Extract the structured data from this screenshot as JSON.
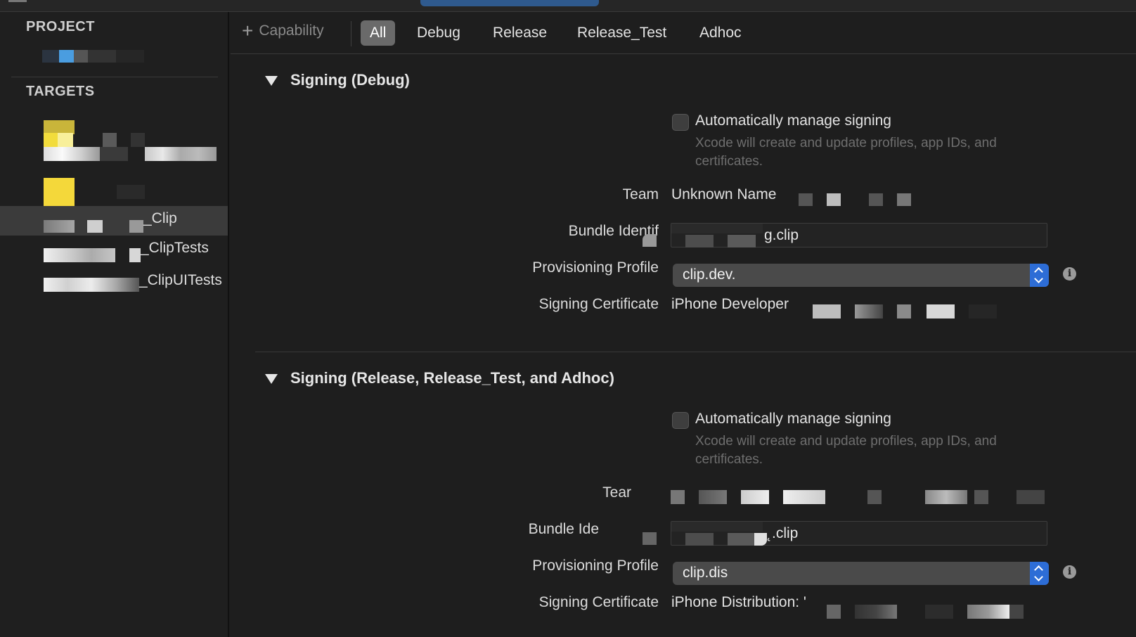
{
  "sidebar": {
    "project_header": "PROJECT",
    "targets_header": "TARGETS",
    "targets": [
      {
        "label": ""
      },
      {
        "label": ""
      },
      {
        "label": ""
      },
      {
        "label": "_Clip",
        "selected": true
      },
      {
        "label": "_ClipTests"
      },
      {
        "label": "_ClipUITests"
      }
    ]
  },
  "toolbar": {
    "add_capability": "Capability",
    "tabs": [
      "All",
      "Debug",
      "Release",
      "Release_Test",
      "Adhoc"
    ],
    "active_tab": "All"
  },
  "signing_debug": {
    "title": "Signing (Debug)",
    "auto_manage_label": "Automatically manage signing",
    "auto_manage_checked": false,
    "help_text": "Xcode will create and update profiles, app IDs, and certificates.",
    "team_label": "Team",
    "team_value": "Unknown Name",
    "bundle_label": "Bundle Identif",
    "bundle_value": "g.clip",
    "profile_label": "Provisioning Profile",
    "profile_value": "clip.dev.",
    "cert_label": "Signing Certificate",
    "cert_value": "iPhone Developer"
  },
  "signing_release": {
    "title": "Signing (Release, Release_Test, and Adhoc)",
    "auto_manage_label": "Automatically manage signing",
    "auto_manage_checked": false,
    "help_text": "Xcode will create and update profiles, app IDs, and certificates.",
    "team_label": "Tear",
    "bundle_label": "Bundle Ide",
    "bundle_value": "˛.clip",
    "profile_label": "Provisioning Profile",
    "profile_value": "clip.dis",
    "cert_label": "Signing Certificate",
    "cert_value": "iPhone Distribution: '"
  },
  "colors": {
    "accent": "#2d6dd6",
    "background": "#1e1e1e",
    "selected_row": "#3b3b3b",
    "app_icon_yellow": "#f4d83a"
  }
}
